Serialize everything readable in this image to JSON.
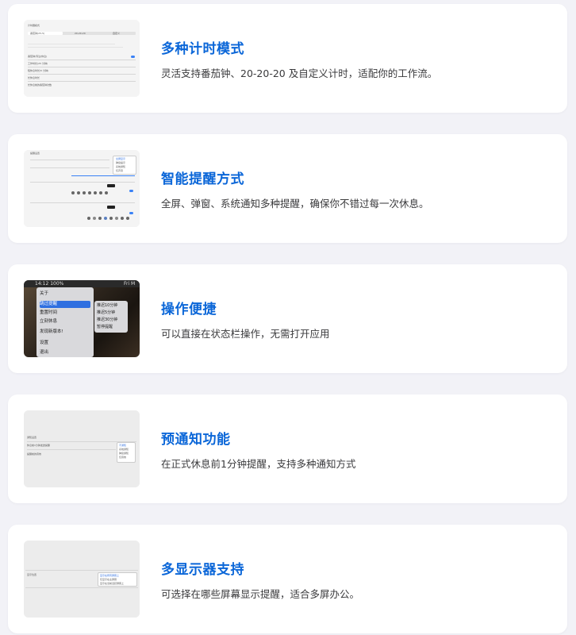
{
  "features": [
    {
      "title": "多种计时模式",
      "description": "灵活支持番茄钟、20-20-20 及自定义计时，适配你的工作流。",
      "thumbnail": {
        "header": "计时器模式",
        "segments": [
          "番茄钟(25-5)",
          "20-20-20",
          "自定义"
        ],
        "rows": [
          "番茄钟(专注/休息)",
          "工作时长(25 分钟)",
          "短休息时长(5 分钟)",
          "长休息时长",
          "长休息前的番茄钟次数"
        ]
      }
    },
    {
      "title": "智能提醒方式",
      "description": "全屏、弹窗、系统通知多种提醒，确保你不错过每一次休息。",
      "thumbnail": {
        "header": "提醒设置",
        "options": [
          "全屏显示",
          "弹窗提示",
          "系统通知",
          "仅声音"
        ]
      }
    },
    {
      "title": "操作便捷",
      "description": "可以直接在状态栏操作，无需打开应用",
      "thumbnail": {
        "menubar": "14:12   100%",
        "menubar_right": "Fri M",
        "menu_items": [
          "关于",
          "跳过提醒",
          "重置时间",
          "立刻休息",
          "发现新版本!",
          "设置",
          "退出"
        ],
        "submenu_items": [
          "推迟10分钟",
          "推迟5分钟",
          "推迟30分钟",
          "暂停提醒"
        ]
      }
    },
    {
      "title": "预通知功能",
      "description": "在正式休息前1分钟提醒，支持多种通知方式",
      "thumbnail": {
        "header": "通知设置",
        "rows": [
          "休息前1分钟发送提醒",
          "提醒前的音效"
        ],
        "options": [
          "不通知",
          "系统通知",
          "弹窗通知",
          "仅音效"
        ]
      }
    },
    {
      "title": "多显示器支持",
      "description": "可选择在哪些屏幕显示提醒，适合多屏办公。",
      "thumbnail": {
        "row": "显示位置",
        "options": [
          "显示在所有屏幕上",
          "仅显示在主屏幕",
          "显示在当前活跃屏幕上"
        ]
      }
    }
  ]
}
